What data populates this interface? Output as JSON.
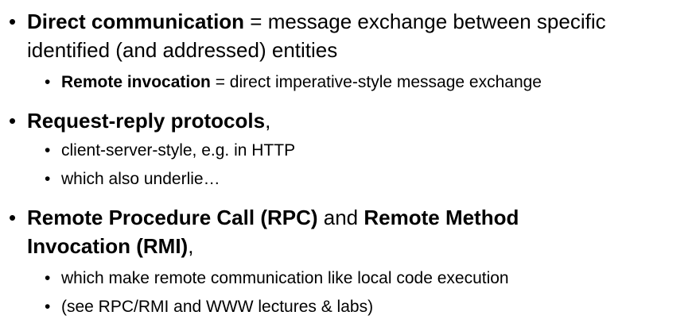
{
  "bullet_glyph": "•",
  "item1": {
    "bold": "Direct communication",
    "rest": " = message exchange between specific",
    "line2": "identified (and addressed) entities",
    "sub1_bold": "Remote invocation",
    "sub1_rest": " = direct imperative-style message exchange"
  },
  "item2": {
    "bold": "Request-reply protocols",
    "rest": ",",
    "sub1": "client-server-style, e.g. in HTTP",
    "sub2": "which also underlie…"
  },
  "item3": {
    "bold1": "Remote Procedure Call (RPC)",
    "mid": " and ",
    "bold2": "Remote Method",
    "line2_bold": "Invocation (RMI)",
    "line2_rest": ",",
    "sub1": "which make remote communication like local code execution",
    "sub2": "(see RPC/RMI and WWW lectures & labs)"
  }
}
